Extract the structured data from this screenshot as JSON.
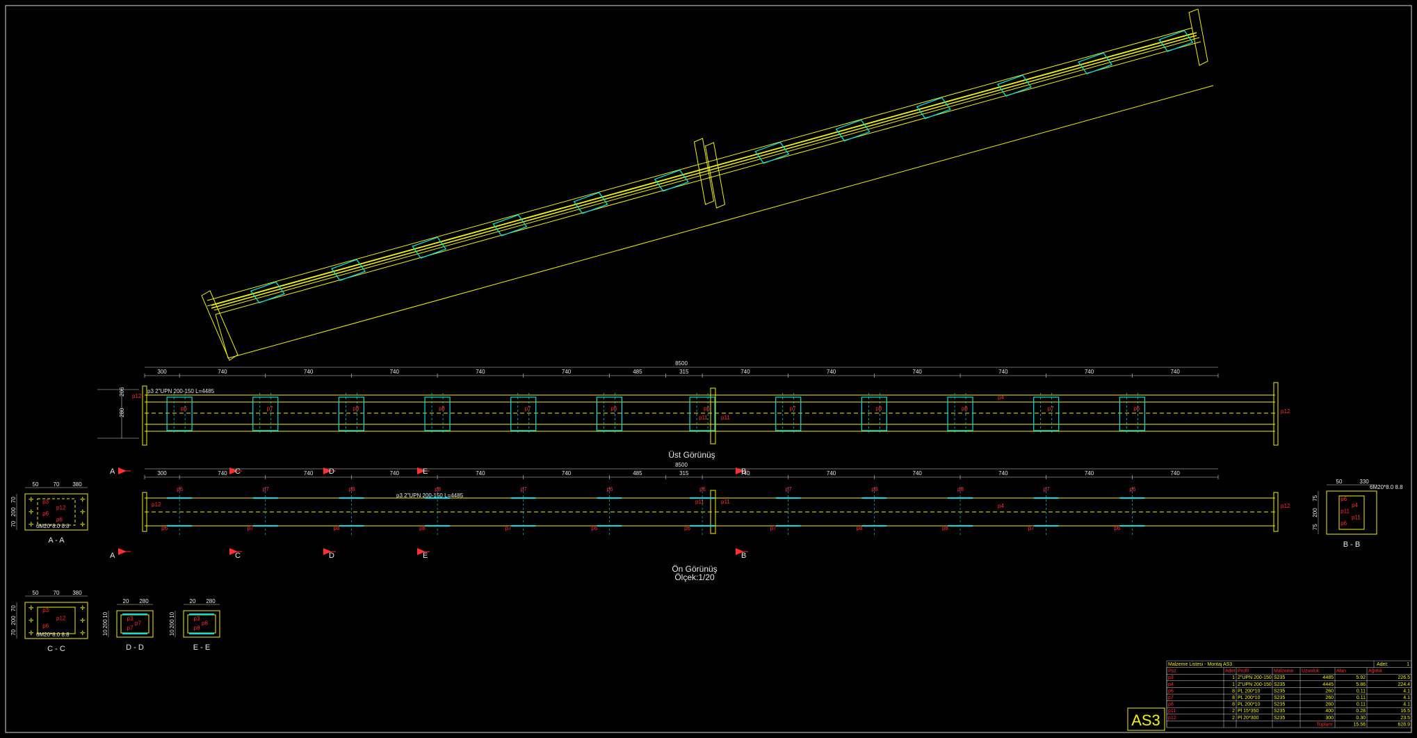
{
  "views": {
    "top_title": "Üst Görünüş",
    "front_title": "Ön Görünüş",
    "scale": "Ölçek:1/20",
    "sheet_code": "AS3"
  },
  "top_view": {
    "total": "8500",
    "spans": [
      "300",
      "740",
      "740",
      "740",
      "740",
      "740",
      "485",
      "315",
      "740",
      "740",
      "740",
      "740",
      "740",
      "740"
    ],
    "profile_note": "p3  2\"UPN 200-150  L=4485",
    "left_dims": [
      "206",
      "280"
    ],
    "right_label": "p12",
    "left_label": "p12",
    "mid_label": "p4",
    "plate_labels": [
      "p6",
      "p7",
      "p8",
      "p8",
      "p7",
      "p6",
      "p6",
      "p7",
      "p8",
      "p8",
      "p7",
      "p6"
    ],
    "splice_labels": [
      "p11",
      "p11"
    ]
  },
  "front_view": {
    "total": "8500",
    "spans": [
      "300",
      "740",
      "740",
      "740",
      "740",
      "740",
      "485",
      "315",
      "740",
      "740",
      "740",
      "740",
      "740",
      "740"
    ],
    "profile_note": "p3  2\"UPN 200-150  L=4485",
    "left_label": "p12",
    "right_label": "p12",
    "mid_label": "p4",
    "top_plates": [
      "p6",
      "p7",
      "p8",
      "p8",
      "p7",
      "p6",
      "p6",
      "p7",
      "p8",
      "p8",
      "p7",
      "p6"
    ],
    "bot_plates": [
      "p6",
      "p7",
      "p8",
      "p8",
      "p7",
      "p6",
      "p6",
      "p7",
      "p8",
      "p8",
      "p7",
      "p6"
    ],
    "splice_labels": [
      "p11",
      "p11"
    ],
    "cuts": [
      "A",
      "C",
      "D",
      "E",
      "B"
    ]
  },
  "sections": {
    "aa": {
      "title": "A - A",
      "dims_top": [
        "50",
        "70",
        "380"
      ],
      "dims_left": [
        "70",
        "200",
        "70"
      ],
      "labels": [
        "p3",
        "p12",
        "p6",
        "p6"
      ],
      "bolt": "6M20*8.0 8.8"
    },
    "bb": {
      "title": "B - B",
      "dims_top": [
        "50",
        "330"
      ],
      "dims_left": [
        "75",
        "200",
        "75"
      ],
      "labels": [
        "p6",
        "p4",
        "p11",
        "p11",
        "p6"
      ],
      "bolt": "6M20*8.0 8.8"
    },
    "cc": {
      "title": "C - C",
      "dims_top": [
        "50",
        "70",
        "380"
      ],
      "dims_left": [
        "70",
        "200",
        "70"
      ],
      "labels": [
        "p3",
        "p12",
        "p6"
      ],
      "bolt": "6M20*8.0 8.8"
    },
    "dd": {
      "title": "D - D",
      "dims_top": [
        "20",
        "280"
      ],
      "dims_left": [
        "10",
        "200",
        "10"
      ],
      "labels": [
        "p3",
        "p7",
        "p7"
      ]
    },
    "ee": {
      "title": "E - E",
      "dims_top": [
        "20",
        "280"
      ],
      "dims_left": [
        "10",
        "200",
        "10"
      ],
      "labels": [
        "p3",
        "p8",
        "p8"
      ]
    }
  },
  "material_list": {
    "title": "Malzeme Listesi - Montaj AS3",
    "qty_label": "Adet:",
    "qty_value": "1",
    "headers": [
      "Poz",
      "Adet",
      "Profil",
      "Malzeme",
      "Uzunluk",
      "Alan",
      "Ağırlık"
    ],
    "rows": [
      [
        "p3",
        "1",
        "2\"UPN 200-150",
        "S235",
        "4485",
        "5.92",
        "226.5"
      ],
      [
        "p4",
        "1",
        "2\"UPN 200-150",
        "S235",
        "4445",
        "5.86",
        "224.4"
      ],
      [
        "p6",
        "8",
        "PL 200*10",
        "S235",
        "260",
        "0.11",
        "4.1"
      ],
      [
        "p7",
        "8",
        "PL 200*10",
        "S235",
        "260",
        "0.11",
        "4.1"
      ],
      [
        "p8",
        "8",
        "PL 200*10",
        "S235",
        "260",
        "0.11",
        "4.1"
      ],
      [
        "p11",
        "2",
        "Pl 15*350",
        "S235",
        "400",
        "0.28",
        "16.5"
      ],
      [
        "p12",
        "2",
        "Pl 20*300",
        "S235",
        "300",
        "0.30",
        "23.5"
      ]
    ],
    "total_label": "Toplam:",
    "total_area": "15.56",
    "total_weight": "628.9"
  },
  "colors": {
    "beam": "#f2f200",
    "plate": "#00e0e0",
    "label": "#ff3030",
    "dim": "#d8d8d8"
  }
}
